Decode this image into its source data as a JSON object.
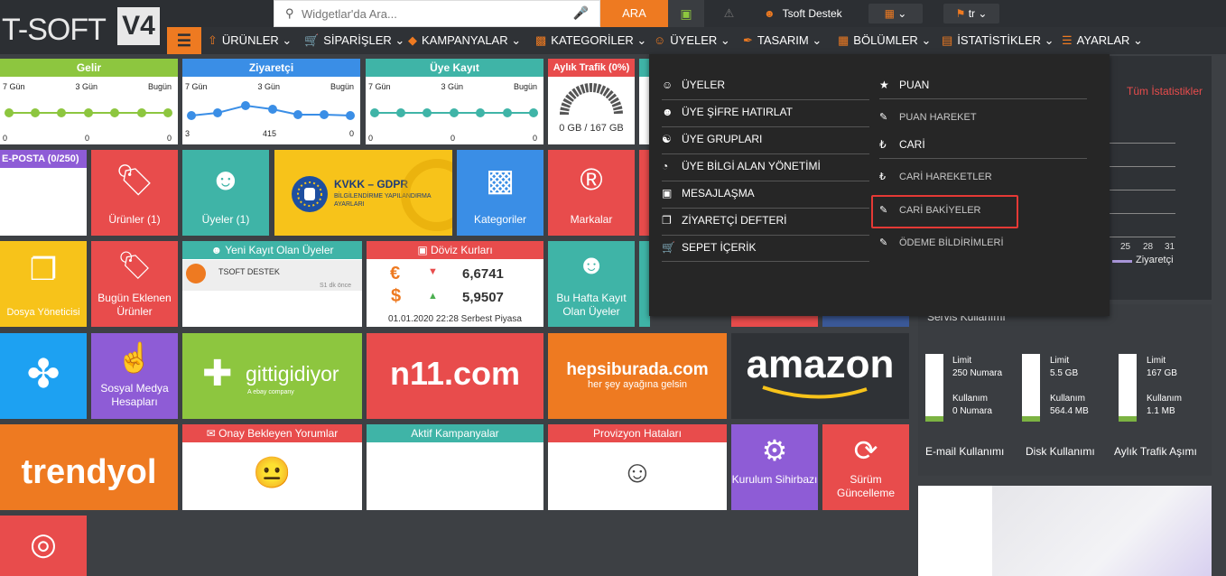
{
  "logo": {
    "text": "T-SOFT",
    "version": "V4"
  },
  "search": {
    "placeholder": "Widgetlar'da Ara...",
    "button": "ARA"
  },
  "user": {
    "name": "Tsoft Destek",
    "lang": "tr"
  },
  "nav": {
    "items": [
      "ÜRÜNLER",
      "SİPARİŞLER",
      "KAMPANYALAR",
      "KATEGORİLER",
      "ÜYELER",
      "TASARIM",
      "BÖLÜMLER",
      "İSTATİSTİKLER",
      "AYARLAR"
    ]
  },
  "stats": [
    {
      "title": "Gelir",
      "labels": [
        "7 Gün",
        "3 Gün",
        "Bugün"
      ],
      "values": [
        "0",
        "0",
        "0"
      ],
      "color": "#8dc63f"
    },
    {
      "title": "Ziyaretçi",
      "labels": [
        "7 Gün",
        "3 Gün",
        "Bugün"
      ],
      "values": [
        "3",
        "415",
        "0"
      ],
      "color": "#3a8ee6"
    },
    {
      "title": "Üye Kayıt",
      "labels": [
        "7 Gün",
        "3 Gün",
        "Bugün"
      ],
      "values": [
        "0",
        "0",
        "0"
      ],
      "color": "#3fb4a7"
    },
    {
      "title": "Aylık Trafik (0%)",
      "subtitle": "0 GB / 167 GB",
      "color": "#e84c4c"
    }
  ],
  "tiles": {
    "eposta": "E-POSTA (0/250)",
    "urunler": "Ürünler (1)",
    "uyeler": "Üyeler (1)",
    "kvkk_title": "KVKK – GDPR",
    "kvkk_sub1": "BİLGİLENDİRME YAPILANDIRMA",
    "kvkk_sub2": "AYARLARI",
    "kategoriler": "Kategoriler",
    "markalar": "Markalar",
    "dosya": "Dosya Yöneticisi",
    "bugun_eklenen": "Bugün Eklenen Ürünler",
    "yeni_kayit_title": "Yeni Kayıt Olan Üyeler",
    "yeni_kayit_name": "TSOFT DESTEK",
    "yeni_kayit_time": "S1 dk önce",
    "doviz_title": "Döviz Kurları",
    "euro": "6,6741",
    "dollar": "5,9507",
    "doviz_date": "01.01.2020 22:28 Serbest Piyasa",
    "bu_hafta": "Bu Hafta Kayıt Olan Üyeler",
    "sosyal": "Sosyal Medya Hesapları",
    "gittigidiyor": "gittigidiyor",
    "gg_sub": "A ebay company",
    "n11": "n11.com",
    "hepsiburada": "hepsiburada.com",
    "hb_sub": "her şey ayağına gelsin",
    "amazon": "amazon",
    "trendyol": "trendyol",
    "onay": "Onay Bekleyen Yorumlar",
    "aktif": "Aktif Kampanyalar",
    "provizyon": "Provizyon Hataları",
    "kurulum": "Kurulum Sihirbazı",
    "surum": "Sürüm Güncelleme"
  },
  "dropdown": {
    "left": [
      "ÜYELER",
      "ÜYE ŞİFRE HATIRLAT",
      "ÜYE GRUPLARI",
      "ÜYE BİLGİ ALAN YÖNETİMİ",
      "MESAJLAŞMA",
      "ZİYARETÇİ DEFTERİ",
      "SEPET İÇERİK"
    ],
    "right_main1": "PUAN",
    "right_sub1": "PUAN HAREKET",
    "right_main2": "CARİ",
    "right_sub2": [
      "CARİ HAREKETLER",
      "CARİ BAKİYELER",
      "ÖDEME BİLDİRİMLERİ"
    ]
  },
  "right": {
    "tum": "Tüm İstatistikler",
    "ticks": [
      "25",
      "28",
      "31"
    ],
    "legend": "Ziyaretçi",
    "servis": "Servis Kullanımı",
    "gauges": [
      {
        "limit": "Limit",
        "limit_val": "250 Numara",
        "used": "Kullanım",
        "used_val": "0 Numara",
        "label": "E-mail Kullanımı"
      },
      {
        "limit": "Limit",
        "limit_val": "5.5 GB",
        "used": "Kullanım",
        "used_val": "564.4 MB",
        "label": "Disk Kullanımı"
      },
      {
        "limit": "Limit",
        "limit_val": "167 GB",
        "used": "Kullanım",
        "used_val": "1.1 MB",
        "label": "Aylık Trafik Aşımı"
      }
    ]
  }
}
